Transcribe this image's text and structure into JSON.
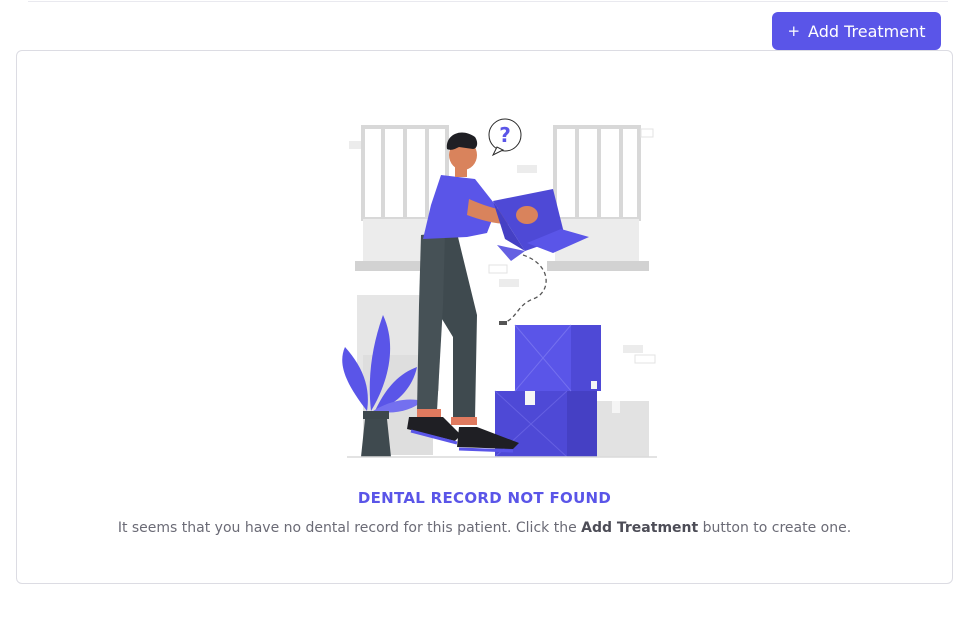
{
  "toolbar": {
    "add_button_icon": "plus-icon",
    "add_button_label": "Add Treatment"
  },
  "empty_state": {
    "illustration": "person-holding-empty-box-illustration",
    "title": "DENTAL RECORD NOT FOUND",
    "description_before": "It seems that you have no dental record for this patient. Click the ",
    "description_bold": "Add Treatment",
    "description_after": " button to create one."
  },
  "colors": {
    "accent": "#5a55e8",
    "text_muted": "#6b6b76",
    "border": "#dcdce3"
  }
}
